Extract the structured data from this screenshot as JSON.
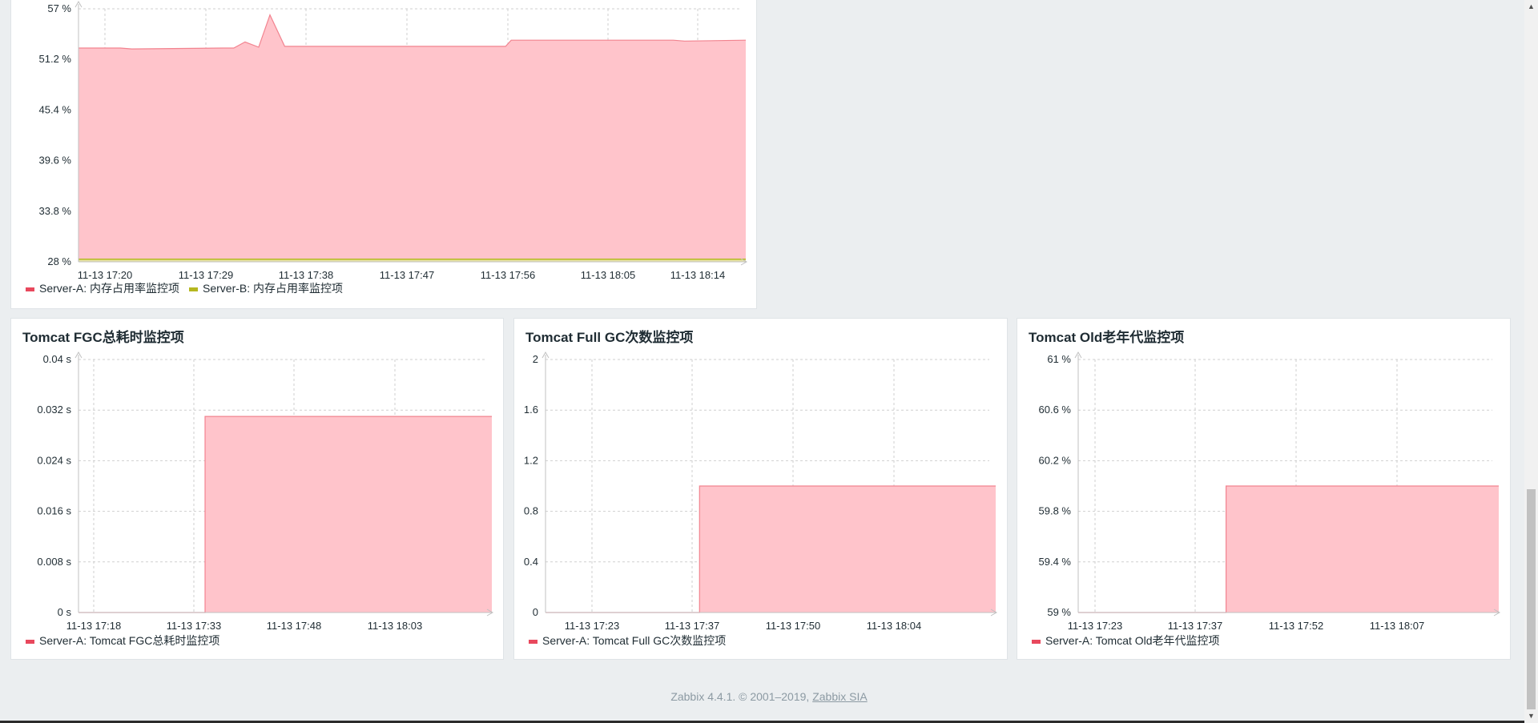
{
  "colors": {
    "series_a_fill": "#ffc4cb",
    "series_a_line": "#f2838f",
    "series_a_legend": "#e8485d",
    "series_b": "#b5b71f"
  },
  "widgets": {
    "memory": {
      "title": "",
      "legend": [
        "Server-A: 内存占用率监控项",
        "Server-B: 内存占用率监控项"
      ]
    },
    "fgc": {
      "title": "Tomcat FGC总耗时监控项",
      "legend": [
        "Server-A: Tomcat FGC总耗时监控项"
      ]
    },
    "fullgc": {
      "title": "Tomcat Full GC次数监控项",
      "legend": [
        "Server-A: Tomcat Full GC次数监控项"
      ]
    },
    "old": {
      "title": "Tomcat Old老年代监控项",
      "legend": [
        "Server-A: Tomcat Old老年代监控项"
      ]
    }
  },
  "footer": {
    "text": "Zabbix 4.4.1. © 2001–2019, ",
    "link": "Zabbix SIA"
  },
  "chart_data": [
    {
      "type": "area",
      "title": "",
      "y_ticks": [
        "28 %",
        "33.8 %",
        "39.6 %",
        "45.4 %",
        "51.2 %",
        "57 %"
      ],
      "ylim": [
        28,
        57
      ],
      "x_ticks": [
        "11-13 17:20",
        "11-13 17:29",
        "11-13 17:38",
        "11-13 17:47",
        "11-13 17:56",
        "11-13 18:05",
        "11-13 18:14"
      ],
      "xlim_minutes": [
        17.3,
        76.2
      ],
      "series": [
        {
          "name": "Server-A: 内存占用率监控项",
          "x_minutes": [
            17.3,
            21,
            22,
            30,
            31,
            32,
            33.2,
            34.2,
            35.5,
            36.5,
            41,
            50,
            55,
            55.5,
            60,
            69.8,
            70.8,
            76.2
          ],
          "values": [
            52.5,
            52.5,
            52.4,
            52.5,
            52.5,
            53.2,
            52.6,
            56.3,
            52.7,
            52.7,
            52.7,
            52.7,
            52.7,
            53.4,
            53.4,
            53.4,
            53.3,
            53.4
          ]
        },
        {
          "name": "Server-B: 内存占用率监控项",
          "x_minutes": [
            17.3,
            23,
            30,
            40,
            50,
            60,
            70,
            76.2
          ],
          "values": [
            28.3,
            28.3,
            28.3,
            28.3,
            28.3,
            28.3,
            28.3,
            28.3
          ]
        }
      ],
      "grid": true,
      "legend": "bottom-left"
    },
    {
      "type": "area",
      "title": "Tomcat FGC总耗时监控项",
      "y_ticks": [
        "0 s",
        "0.008 s",
        "0.016 s",
        "0.024 s",
        "0.032 s",
        "0.04 s"
      ],
      "ylim": [
        0,
        0.04
      ],
      "x_ticks": [
        "11-13 17:18",
        "11-13 17:33",
        "11-13 17:48",
        "11-13 18:03"
      ],
      "xlim_minutes": [
        17.3,
        77.4
      ],
      "series": [
        {
          "name": "Server-A: Tomcat FGC总耗时监控项",
          "x_minutes": [
            17.3,
            35.7,
            35.7,
            77.4
          ],
          "values": [
            0,
            0,
            0.031,
            0.031
          ]
        }
      ],
      "grid": true,
      "legend": "bottom-left"
    },
    {
      "type": "area",
      "title": "Tomcat Full GC次数监控项",
      "y_ticks": [
        "0",
        "0.4",
        "0.8",
        "1.2",
        "1.6",
        "2"
      ],
      "ylim": [
        0,
        2
      ],
      "x_ticks": [
        "11-13 17:23",
        "11-13 17:37",
        "11-13 17:50",
        "11-13 18:04"
      ],
      "xlim_minutes": [
        17.3,
        78.1
      ],
      "series": [
        {
          "name": "Server-A: Tomcat Full GC次数监控项",
          "x_minutes": [
            17.3,
            38.1,
            38.1,
            78.1
          ],
          "values": [
            0,
            0,
            1,
            1
          ]
        }
      ],
      "grid": true,
      "legend": "bottom-left"
    },
    {
      "type": "area",
      "title": "Tomcat Old老年代监控项",
      "y_ticks": [
        "59 %",
        "59.4 %",
        "59.8 %",
        "60.2 %",
        "60.6 %",
        "61 %"
      ],
      "ylim": [
        59,
        61
      ],
      "x_ticks": [
        "11-13 17:23",
        "11-13 17:37",
        "11-13 17:52",
        "11-13 18:07"
      ],
      "xlim_minutes": [
        17.3,
        79.0
      ],
      "series": [
        {
          "name": "Server-A: Tomcat Old老年代监控项",
          "x_minutes": [
            17.3,
            39.0,
            39.0,
            79.0
          ],
          "values": [
            59,
            59,
            60,
            60
          ]
        }
      ],
      "grid": true,
      "legend": "bottom-left"
    }
  ]
}
